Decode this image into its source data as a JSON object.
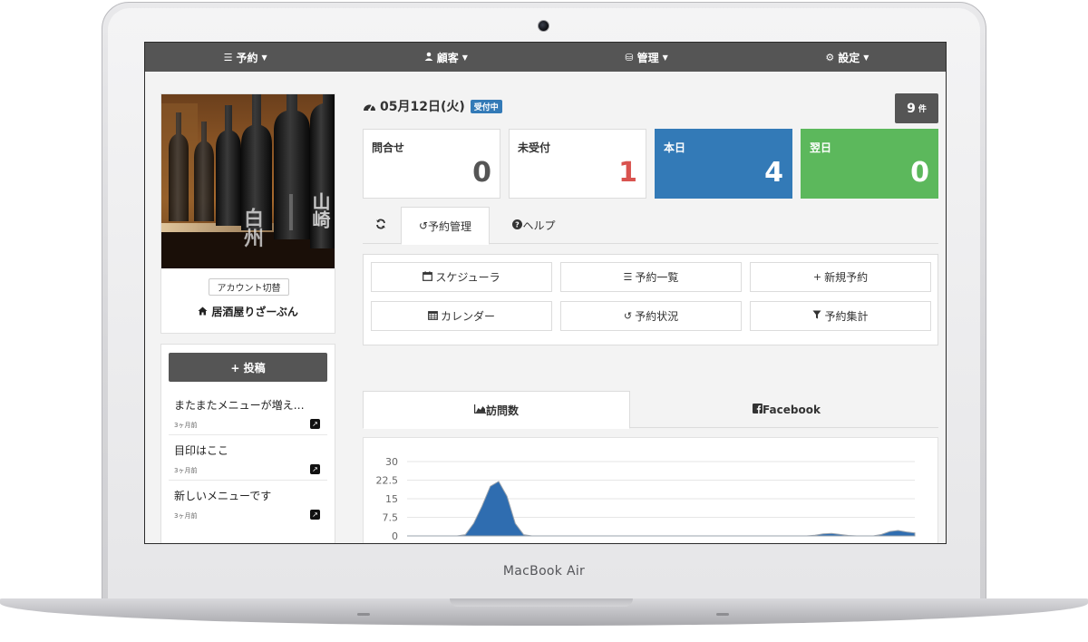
{
  "device": {
    "brand": "MacBook Air"
  },
  "nav": [
    {
      "icon": "list-icon",
      "glyph": "☰",
      "label": "予約"
    },
    {
      "icon": "user-icon",
      "glyph": "👤",
      "label": "顧客"
    },
    {
      "icon": "database-icon",
      "glyph": "⛁",
      "label": "管理"
    },
    {
      "icon": "gear-icon",
      "glyph": "⚙",
      "label": "設定"
    }
  ],
  "profile": {
    "account_switch_label": "アカウント切替",
    "shop_name": "居酒屋りざーぶん",
    "photo_sign_1": "白州",
    "photo_sign_2": "山崎"
  },
  "posts": {
    "post_button_label": "+ 投稿",
    "items": [
      {
        "title": "またまたメニューが増え…",
        "time": "3ヶ月前"
      },
      {
        "title": "目印はここ",
        "time": "3ヶ月前"
      },
      {
        "title": "新しいメニューです",
        "time": "3ヶ月前"
      }
    ]
  },
  "header": {
    "date": "05月12日(火)",
    "status": "受付中",
    "count_value": "9",
    "count_unit": "件"
  },
  "stats": [
    {
      "label": "問合せ",
      "value": "0"
    },
    {
      "label": "未受付",
      "value": "1"
    },
    {
      "label": "本日",
      "value": "4"
    },
    {
      "label": "翌日",
      "value": "0"
    }
  ],
  "tabs": {
    "reservation_mgmt": "予約管理",
    "help": "ヘルプ"
  },
  "menu": [
    {
      "icon": "calendar-icon",
      "label": "スケジューラ"
    },
    {
      "icon": "list-icon",
      "label": "予約一覧"
    },
    {
      "icon": "plus-icon",
      "label": "新規予約"
    },
    {
      "icon": "calendar-grid-icon",
      "label": "カレンダー"
    },
    {
      "icon": "history-icon",
      "label": "予約状況"
    },
    {
      "icon": "filter-icon",
      "label": "予約集計"
    }
  ],
  "chart_tabs": {
    "visits": "訪問数",
    "facebook": "Facebook"
  },
  "chart_data": {
    "type": "area",
    "yticks": [
      "30",
      "22.5",
      "15",
      "7.5",
      "0"
    ],
    "ylim": [
      0,
      30
    ],
    "series": [
      {
        "color": "#2f6db0",
        "values": [
          0,
          0,
          0,
          0,
          0,
          0,
          0,
          0.5,
          5,
          12,
          20,
          22,
          16,
          5,
          0.5,
          0,
          0,
          0,
          0,
          0,
          0,
          0,
          0,
          0,
          0,
          0,
          0,
          0,
          0,
          0,
          0,
          0,
          0,
          0,
          0,
          0,
          0,
          0,
          0,
          0,
          0,
          0,
          0,
          0,
          0,
          0,
          0,
          0,
          0,
          0.3,
          0.8,
          1,
          0.6,
          0.2,
          0,
          0,
          0,
          0.6,
          1.8,
          2.2,
          1.6,
          1.2
        ]
      }
    ],
    "grid": true
  }
}
